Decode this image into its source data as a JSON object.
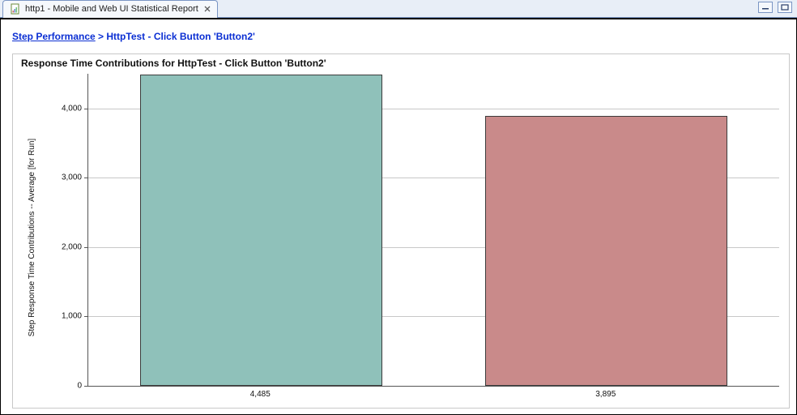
{
  "tab": {
    "title": "http1 - Mobile and Web UI Statistical Report"
  },
  "breadcrumb": {
    "link": "Step Performance",
    "sep": " > ",
    "current": "HttpTest - Click Button 'Button2'"
  },
  "chart_data": {
    "type": "bar",
    "title": "Response Time Contributions for HttpTest - Click Button 'Button2'",
    "ylabel": "Step Response Time Contributions -- Average [for Run]",
    "ylim": [
      0,
      4500
    ],
    "yticks": [
      0,
      1000,
      2000,
      3000,
      4000
    ],
    "ytick_labels": [
      "0",
      "1,000",
      "2,000",
      "3,000",
      "4,000"
    ],
    "categories": [
      "4,485",
      "3,895"
    ],
    "values": [
      4485,
      3895
    ],
    "colors": [
      "#8fc1ba",
      "#c98a8a"
    ]
  }
}
